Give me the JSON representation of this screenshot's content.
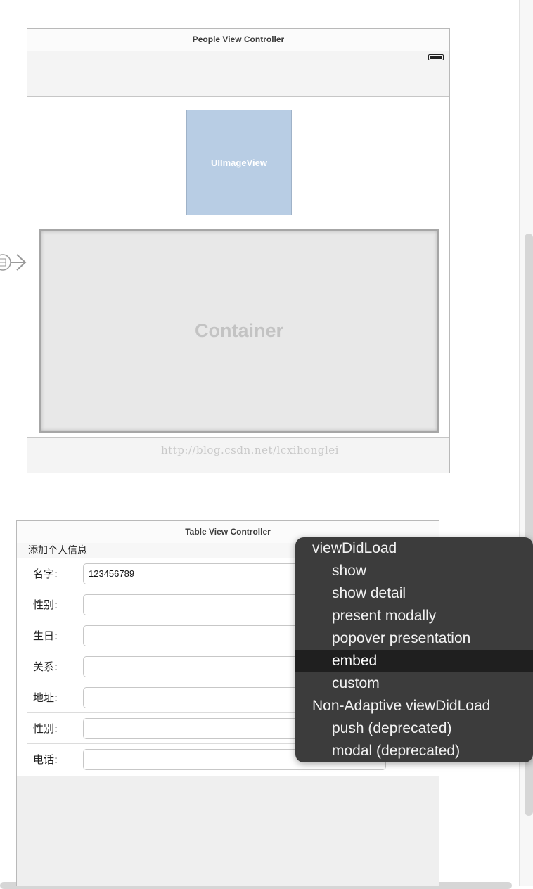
{
  "people_vc": {
    "title": "People View Controller",
    "imageview_label": "UIImageView",
    "container_label": "Container",
    "watermark": "http://blog.csdn.net/lcxihonglei"
  },
  "table_vc": {
    "title": "Table View Controller",
    "section_header": "添加个人信息",
    "rows": [
      {
        "label": "名字:",
        "value": "123456789"
      },
      {
        "label": "性别:",
        "value": ""
      },
      {
        "label": "生日:",
        "value": ""
      },
      {
        "label": "关系:",
        "value": ""
      },
      {
        "label": "地址:",
        "value": ""
      },
      {
        "label": "性别:",
        "value": ""
      },
      {
        "label": "电话:",
        "value": ""
      }
    ]
  },
  "segue_menu": {
    "items": [
      {
        "label": "viewDidLoad",
        "kind": "header"
      },
      {
        "label": "show",
        "kind": "sub"
      },
      {
        "label": "show detail",
        "kind": "sub"
      },
      {
        "label": "present modally",
        "kind": "sub"
      },
      {
        "label": "popover presentation",
        "kind": "sub"
      },
      {
        "label": "embed",
        "kind": "sub",
        "selected": true
      },
      {
        "label": "custom",
        "kind": "sub"
      },
      {
        "label": "Non-Adaptive viewDidLoad",
        "kind": "header"
      },
      {
        "label": "push (deprecated)",
        "kind": "sub"
      },
      {
        "label": "modal (deprecated)",
        "kind": "sub"
      }
    ]
  },
  "colors": {
    "imageview_fill": "#b8cde4",
    "menu_background": "#3c3c3c",
    "menu_selected": "#1f1f1f"
  }
}
